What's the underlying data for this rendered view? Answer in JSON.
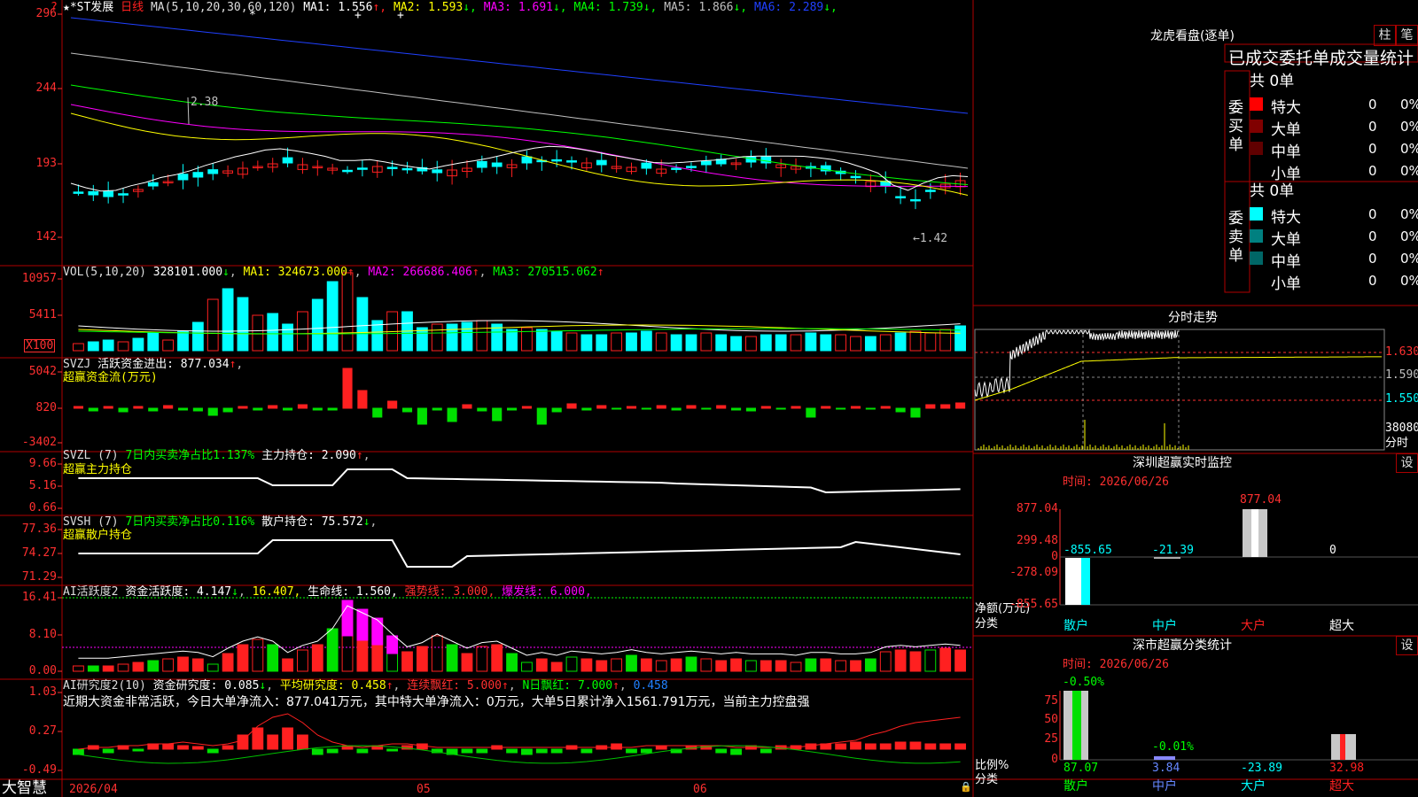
{
  "colors": {
    "up": "#ff2020",
    "down": "#00ffff",
    "bg": "#000000",
    "frame": "#b00000",
    "axis": "#ff3030",
    "white": "#ffffff",
    "yellow": "#ffff00",
    "magenta": "#ff00ff",
    "green": "#00ff00",
    "blue": "#2040ff",
    "gray": "#c0c0c0"
  },
  "kline": {
    "header_prefix": "★*ST发展",
    "period": "日线",
    "ma_name": "MA(5,10,20,30,60,120)",
    "ma": [
      {
        "label": "MA1:",
        "value": "1.556",
        "arrow": "↑",
        "color": "#ffffff"
      },
      {
        "label": "MA2:",
        "value": "1.593",
        "arrow": "↓",
        "color": "#ffff00"
      },
      {
        "label": "MA3:",
        "value": "1.691",
        "arrow": "↓",
        "color": "#ff00ff"
      },
      {
        "label": "MA4:",
        "value": "1.739",
        "arrow": "↓",
        "color": "#00ff00"
      },
      {
        "label": "MA5:",
        "value": "1.866",
        "arrow": "↓",
        "color": "#c0c0c0"
      },
      {
        "label": "MA6:",
        "value": "2.289",
        "arrow": "↓",
        "color": "#2040ff"
      }
    ],
    "y_ticks": [
      "296",
      "244",
      "193",
      "142"
    ],
    "hi_label": "2.38",
    "lo_label": "1.42",
    "top_marker": "?"
  },
  "vol": {
    "name": "VOL(5,10,20)",
    "value": "328101.000",
    "ma1": "MA1: 324673.000",
    "ma2": "MA2: 266686.406",
    "ma3": "MA3: 270515.062",
    "y_ticks": [
      "10957",
      "5411"
    ],
    "unit": "X100"
  },
  "svzj": {
    "name": "SVZJ",
    "title": "活跃资金进出: 877.034",
    "subtitle": "超赢资金流(万元)",
    "y_ticks": [
      "5042",
      "820",
      "-3402"
    ]
  },
  "svzl": {
    "name": "SVZL (7)",
    "ratio": "7日内买卖净占比1.137%",
    "hold": "主力持仓: 2.090",
    "subtitle": "超赢主力持仓",
    "y_ticks": [
      "9.66",
      "5.16",
      "0.66"
    ]
  },
  "svsh": {
    "name": "SVSH (7)",
    "ratio": "7日内买卖净占比0.116%",
    "hold": "散户持仓: 75.572",
    "subtitle": "超赢散户持仓",
    "y_ticks": [
      "77.36",
      "74.27",
      "71.29"
    ]
  },
  "ai1": {
    "name": "AI活跃度2",
    "active": "资金活跃度: 4.147",
    "v2": "16.407,",
    "life": "生命线: 1.560,",
    "strong": "强势线: 3.000,",
    "burst": "爆发线: 6.000,",
    "y_ticks": [
      "16.41",
      "8.10",
      "0.00"
    ]
  },
  "ai2": {
    "name": "AI研究度2(10)",
    "research": "资金研究度: 0.085",
    "avg": "平均研究度: 0.458",
    "cont": "连续飘红: 5.000",
    "nday": "N日飘红: 7.000",
    "last": "0.458",
    "desc": "近期大资金非常活跃，今日大单净流入：877.041万元，其中特大单净流入：0万元，大单5日累计净入1561.791万元，当前主力控盘强",
    "y_ticks": [
      "1.03",
      "0.27",
      "-0.49"
    ]
  },
  "xaxis": {
    "labels": [
      "2026/04",
      "05",
      "06"
    ]
  },
  "brand": "大智慧",
  "right": {
    "lhkp_title": "龙虎看盘(逐单)",
    "btn_zhu": "柱",
    "btn_bi": "笔",
    "stats_title": "已成交委托单成交量统计",
    "buy_label": "委买单",
    "sell_label": "委卖单",
    "buy_total": "共 0单",
    "sell_total": "共 0单",
    "buy_rows": [
      {
        "name": "特大",
        "n": "0",
        "p": "0%",
        "c": "#ff0000"
      },
      {
        "name": "大单",
        "n": "0",
        "p": "0%",
        "c": "#800000"
      },
      {
        "name": "中单",
        "n": "0",
        "p": "0%",
        "c": "#600000"
      },
      {
        "name": "小单",
        "n": "0",
        "p": "0%",
        "c": ""
      }
    ],
    "sell_rows": [
      {
        "name": "特大",
        "n": "0",
        "p": "0%",
        "c": "#00ffff"
      },
      {
        "name": "大单",
        "n": "0",
        "p": "0%",
        "c": "#008080"
      },
      {
        "name": "中单",
        "n": "0",
        "p": "0%",
        "c": "#006666"
      },
      {
        "name": "小单",
        "n": "0",
        "p": "0%",
        "c": ""
      }
    ],
    "fenshi_title": "分时走势",
    "fenshi_prices": [
      "1.630",
      "1.590",
      "1.550"
    ],
    "fenshi_vol": "38080",
    "fenshi_unit": "分时",
    "monitor_title": "深圳超赢实时监控",
    "monitor_time": "时间: 2026/06/26",
    "monitor_set": "设",
    "monitor_y": [
      "877.04",
      "299.48",
      "0",
      "-278.09",
      "-855.65"
    ],
    "monitor_top": "877.04",
    "monitor_vals": [
      "-855.65",
      "-21.39",
      "",
      "0"
    ],
    "monitor_unit": "净额(万元)",
    "monitor_cat_label": "分类",
    "categories": [
      "散户",
      "中户",
      "大户",
      "超大"
    ],
    "class_title": "深市超赢分类统计",
    "class_time": "时间: 2026/06/26",
    "class_set": "设",
    "class_y": [
      "75",
      "50",
      "25",
      "0"
    ],
    "class_pct": [
      "-0.50%",
      "-0.01%"
    ],
    "class_unit": "比例%",
    "class_cat_label": "分类",
    "class_vals": [
      "87.07",
      "3.84",
      "-23.89",
      "32.98"
    ]
  }
}
